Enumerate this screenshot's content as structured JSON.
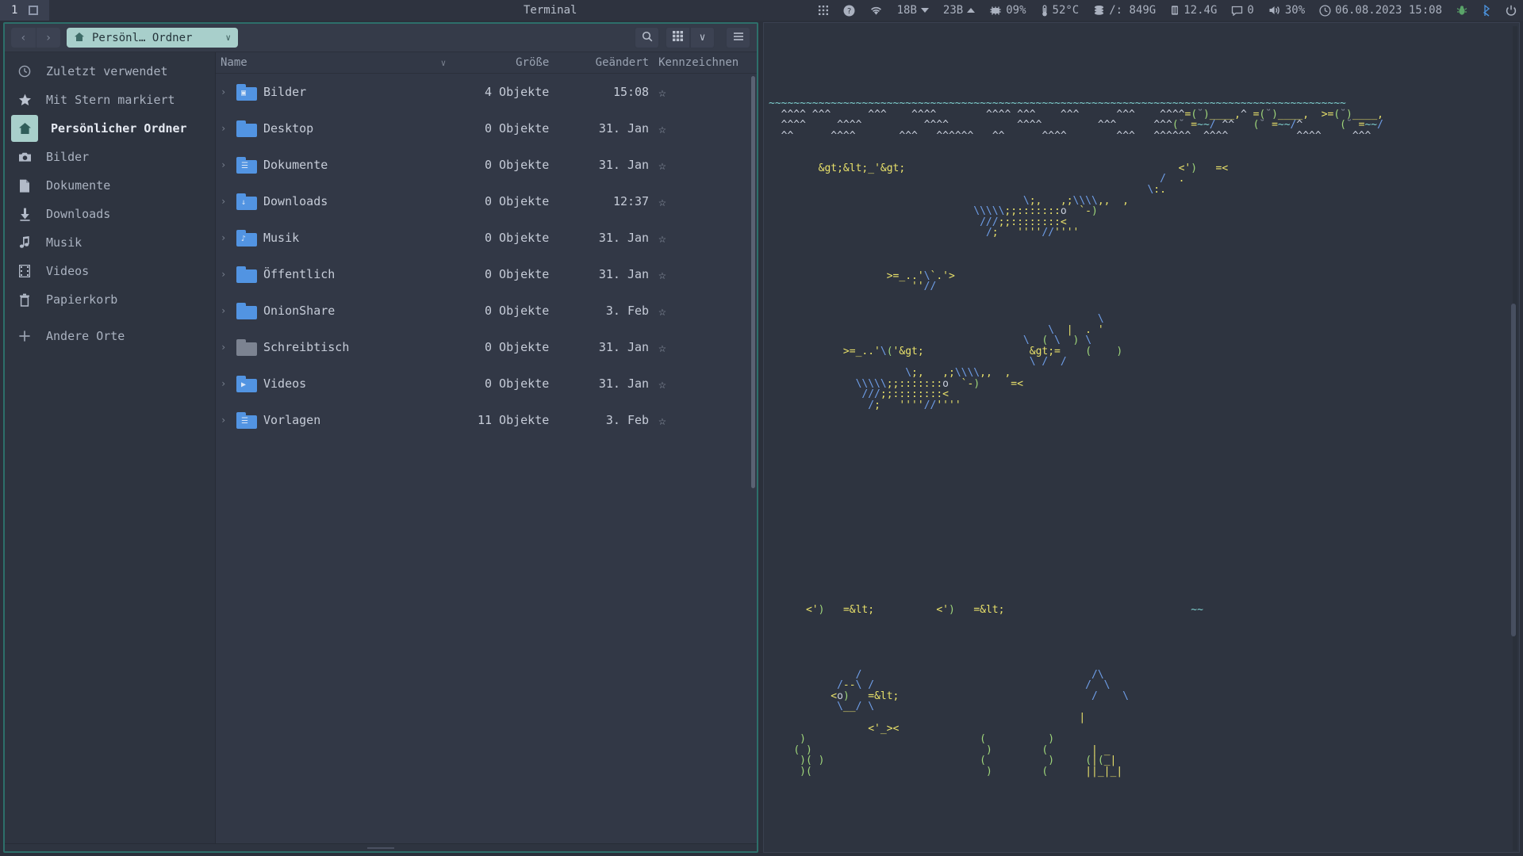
{
  "topbar": {
    "workspace": "1",
    "workspace_icon": "window-box-icon",
    "window_title": "Terminal",
    "tray": [
      {
        "name": "apps-grid",
        "icon": "grid-icon",
        "label": ""
      },
      {
        "name": "help",
        "icon": "question-circle-icon",
        "label": ""
      },
      {
        "name": "wifi",
        "icon": "wifi-icon",
        "label": ""
      },
      {
        "name": "net-down",
        "icon": "arrow-down-icon",
        "label": "18B"
      },
      {
        "name": "net-up",
        "icon": "arrow-up-icon",
        "label": "23B"
      },
      {
        "name": "cpu",
        "icon": "cpu-chip-icon",
        "label": "09%"
      },
      {
        "name": "temperature",
        "icon": "thermometer-icon",
        "label": "52°C"
      },
      {
        "name": "disk",
        "icon": "disk-stack-icon",
        "label": "/: 849G"
      },
      {
        "name": "memory",
        "icon": "memory-icon",
        "label": "12.4G"
      },
      {
        "name": "notifications",
        "icon": "message-icon",
        "label": "0"
      },
      {
        "name": "volume",
        "icon": "speaker-icon",
        "label": "30%"
      },
      {
        "name": "clock",
        "icon": "clock-icon",
        "label": "06.08.2023  15:08"
      },
      {
        "name": "bug",
        "icon": "bug-icon",
        "label": ""
      },
      {
        "name": "bluetooth",
        "icon": "bluetooth-icon",
        "label": ""
      },
      {
        "name": "power",
        "icon": "power-icon",
        "label": ""
      }
    ]
  },
  "filemanager": {
    "nav": {
      "back": "‹",
      "forward": "›"
    },
    "path": {
      "icon": "home-icon",
      "label": "Persönl… Ordner",
      "chevron": "∨"
    },
    "toolbar": {
      "search": "search-icon",
      "grid_view": "grid-view-icon",
      "view_chevron": "∨",
      "menu": "hamburger-menu-icon"
    },
    "sidebar": [
      {
        "label": "Zuletzt verwendet",
        "icon": "clock-icon",
        "active": false
      },
      {
        "label": "Mit Stern markiert",
        "icon": "star-icon",
        "active": false
      },
      {
        "label": "Persönlicher Ordner",
        "icon": "home-icon",
        "active": true
      },
      {
        "label": "Bilder",
        "icon": "camera-icon",
        "active": false
      },
      {
        "label": "Dokumente",
        "icon": "document-icon",
        "active": false
      },
      {
        "label": "Downloads",
        "icon": "download-icon",
        "active": false
      },
      {
        "label": "Musik",
        "icon": "music-note-icon",
        "active": false
      },
      {
        "label": "Videos",
        "icon": "film-icon",
        "active": false
      },
      {
        "label": "Papierkorb",
        "icon": "trash-icon",
        "active": false
      },
      {
        "label": "Andere Orte",
        "icon": "plus-icon",
        "active": false
      }
    ],
    "columns": [
      "Name",
      "Größe",
      "Geändert",
      "Kennzeichnen"
    ],
    "rows": [
      {
        "name": "Bilder",
        "size": "4 Objekte",
        "modified": "15:08",
        "icon": "folder-pictures-icon",
        "gray": false,
        "emb": "▣"
      },
      {
        "name": "Desktop",
        "size": "0 Objekte",
        "modified": "31. Jan",
        "icon": "folder-icon",
        "gray": false,
        "emb": ""
      },
      {
        "name": "Dokumente",
        "size": "0 Objekte",
        "modified": "31. Jan",
        "icon": "folder-documents-icon",
        "gray": false,
        "emb": "☰"
      },
      {
        "name": "Downloads",
        "size": "0 Objekte",
        "modified": "12:37",
        "icon": "folder-downloads-icon",
        "gray": false,
        "emb": "↓"
      },
      {
        "name": "Musik",
        "size": "0 Objekte",
        "modified": "31. Jan",
        "icon": "folder-music-icon",
        "gray": false,
        "emb": "♪"
      },
      {
        "name": "Öffentlich",
        "size": "0 Objekte",
        "modified": "31. Jan",
        "icon": "folder-public-icon",
        "gray": false,
        "emb": ""
      },
      {
        "name": "OnionShare",
        "size": "0 Objekte",
        "modified": "3. Feb",
        "icon": "folder-icon",
        "gray": false,
        "emb": ""
      },
      {
        "name": "Schreibtisch",
        "size": "0 Objekte",
        "modified": "31. Jan",
        "icon": "folder-inaccessible-icon",
        "gray": true,
        "emb": ""
      },
      {
        "name": "Videos",
        "size": "0 Objekte",
        "modified": "31. Jan",
        "icon": "folder-videos-icon",
        "gray": false,
        "emb": "▶"
      },
      {
        "name": "Vorlagen",
        "size": "11 Objekte",
        "modified": "3. Feb",
        "icon": "folder-templates-icon",
        "gray": false,
        "emb": "☰"
      }
    ],
    "star_glyph": "☆"
  },
  "terminal": {
    "program": "asciiquarium",
    "art_lines": [
      "",
      "",
      "",
      "",
      "",
      "",
      "",
      "~~~~~~~~~~~~~~~~~~~~~~~~~~~~~~~~~~~~~~~~~~~~~~~~~~~~~~~~~~~~~~~~~~~~~~~~~~~~~~~~~~~~~~~~~~~~~",
      "  ^^^^ ^^^      ^^^    ^^^^        ^^^^ ^^^    ^^^      ^^^    ^^^^=(˘)____,^ =(˘)____,  >=(˘)____,",
      "  ^^^^     ^^^^          ^^^^           ^^^^         ^^^      ^^^(˘ =~~/ ^^   (˘ =~~/^      (˘ =~~/",
      "  ^^      ^^^^       ^^^   ^^^^^^   ^^      ^^^^        ^^^   ^^^^^^  ^^^^           ^^^^     ^^^",
      "",
      "",
      "        ><_'>                                            <')   =<",
      "                                                               /  .",
      "                                                             \\:.",
      "                                         \\;,   ,;\\\\\\\\,,  ,",
      "                                 \\\\\\\\\\;;:::::::o  `-)",
      "                                  ///;;::::::::<",
      "                                   /;   ''''//''''",
      "",
      "",
      "",
      "                   >=_..'\\`.'>",
      "                       ''//",
      "",
      "",
      "                                                     \\",
      "                                             \\  |  . '",
      "                                         \\  ( \\  ) \\",
      "            >=_..'\\('>                 >=    (    )",
      "                                          \\ /  /",
      "                      \\;,   ,;\\\\\\\\,,  ,",
      "              \\\\\\\\\\;;:::::::o  `-)     =<",
      "               ///;;::::::::<",
      "                /;   ''''//''''",
      "",
      "",
      "",
      "",
      "",
      "",
      "",
      "",
      "",
      "",
      "",
      "",
      "",
      "",
      "",
      "",
      "",
      "",
      "      <')   =<          <')   =<                              ~~",
      "                                                               ",
      "",
      "",
      "",
      "",
      "              /                                     /\\",
      "           /--\\ /                                  /  \\",
      "          <o)   =<                               /    \\",
      "           \\__/ \\",
      "                                                  |",
      "                <'_><",
      "     )                            (          )",
      "    ( )                            )        (       | _",
      "     )( )                         (          )     (|(_|",
      "     )(                            )        (      ||_|_|"
    ]
  }
}
